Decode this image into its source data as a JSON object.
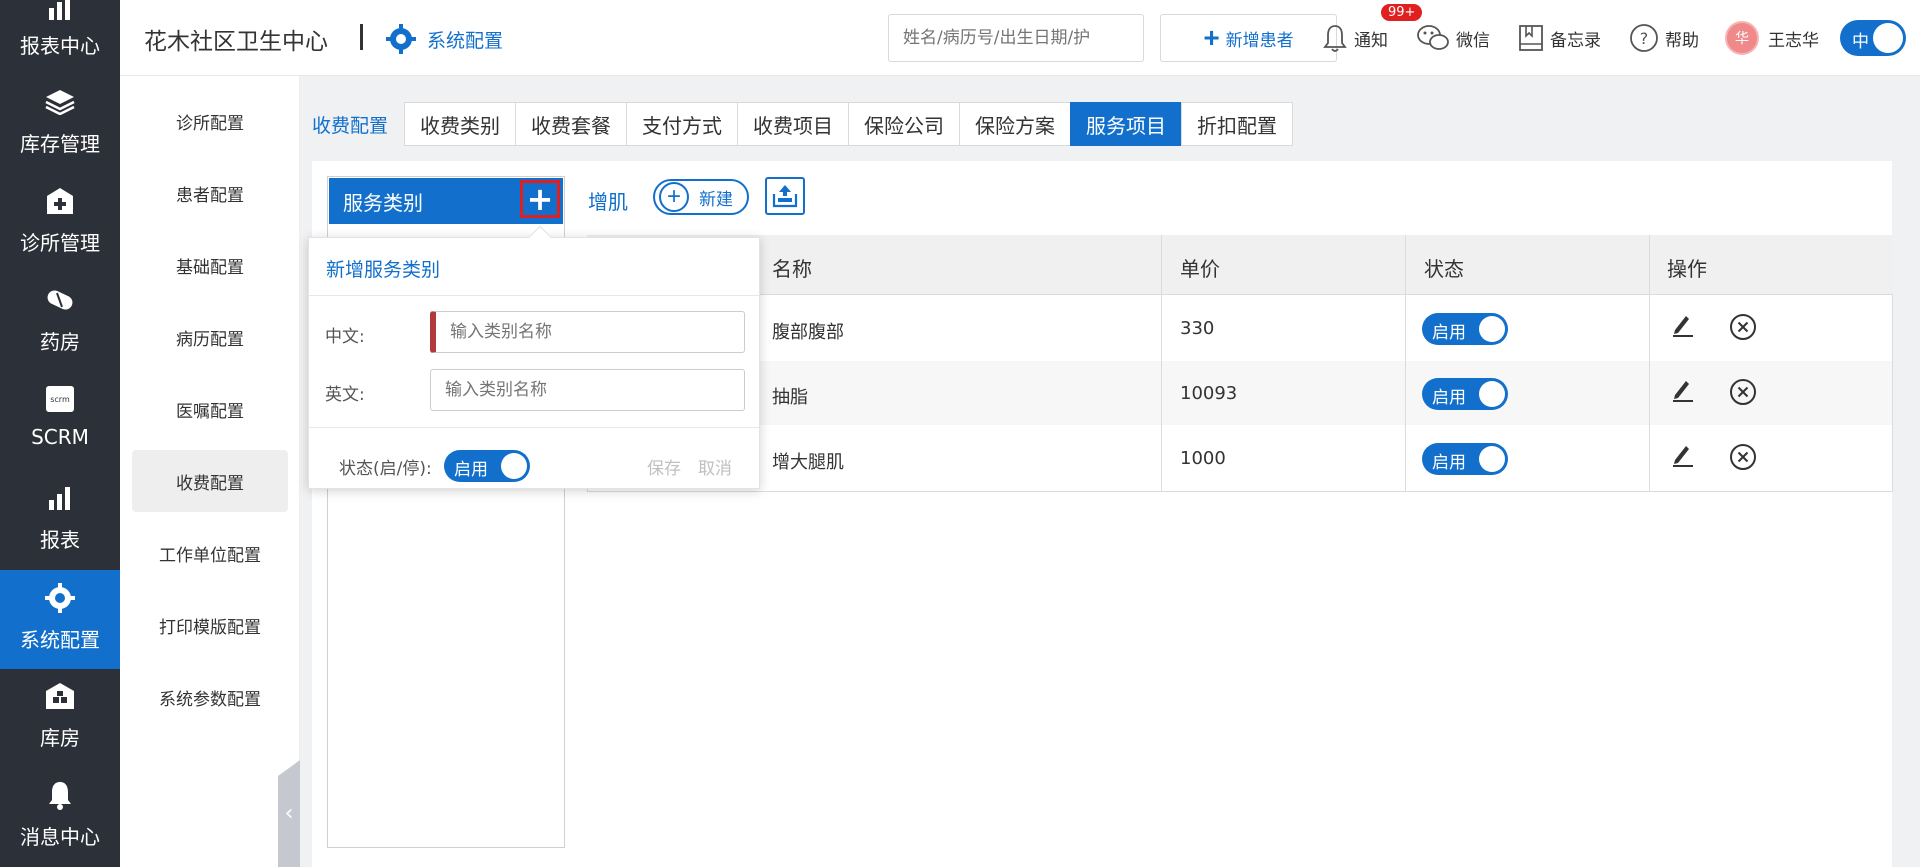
{
  "leftnav": {
    "items": [
      {
        "label": "报表中心",
        "icon": "chart-icon"
      },
      {
        "label": "库存管理",
        "icon": "layers-icon"
      },
      {
        "label": "诊所管理",
        "icon": "clinic-icon"
      },
      {
        "label": "药房",
        "icon": "pill-icon"
      },
      {
        "label": "SCRM",
        "icon": "scrm-icon"
      },
      {
        "label": "报表",
        "icon": "bar-chart-icon"
      },
      {
        "label": "系统配置",
        "icon": "gear-icon"
      },
      {
        "label": "库房",
        "icon": "warehouse-icon"
      },
      {
        "label": "消息中心",
        "icon": "bell-icon"
      }
    ],
    "active_index": 6
  },
  "header": {
    "clinic_name": "花木社区卫生中心",
    "module_title": "系统配置",
    "search_placeholder": "姓名/病历号/出生日期/护",
    "add_patient_label": "新增患者",
    "notify_label": "通知",
    "notify_badge": "99+",
    "wechat_label": "微信",
    "memo_label": "备忘录",
    "help_label": "帮助",
    "avatar_text": "华",
    "user_name": "王志华",
    "lang_toggle": "中"
  },
  "subnav": {
    "items": [
      "诊所配置",
      "患者配置",
      "基础配置",
      "病历配置",
      "医嘱配置",
      "收费配置",
      "工作单位配置",
      "打印模版配置",
      "系统参数配置"
    ],
    "active_index": 5
  },
  "tabs": {
    "section_label": "收费配置",
    "items": [
      "收费类别",
      "收费套餐",
      "支付方式",
      "收费项目",
      "保险公司",
      "保险方案",
      "服务项目",
      "折扣配置"
    ],
    "active_index": 6
  },
  "category": {
    "header": "服务类别",
    "add_icon": "plus-icon"
  },
  "toolbar": {
    "current_category": "增肌",
    "new_label": "新建",
    "upload_icon": "upload-icon"
  },
  "table": {
    "columns": [
      "名称",
      "单价",
      "状态",
      "操作"
    ],
    "rows": [
      {
        "name": "腹部腹部",
        "price": "330",
        "status": "启用"
      },
      {
        "name": "抽脂",
        "price": "10093",
        "status": "启用"
      },
      {
        "name": "增大腿肌",
        "price": "1000",
        "status": "启用"
      }
    ]
  },
  "popover": {
    "title": "新增服务类别",
    "zh_label": "中文:",
    "zh_placeholder": "输入类别名称",
    "en_label": "英文:",
    "en_placeholder": "输入类别名称",
    "status_label": "状态(启/停):",
    "status_value": "启用",
    "save_label": "保存",
    "cancel_label": "取消"
  },
  "colors": {
    "primary": "#1270cc",
    "nav_bg": "#2c3038",
    "badge": "#e02020",
    "required_marker": "#b03a3a"
  }
}
